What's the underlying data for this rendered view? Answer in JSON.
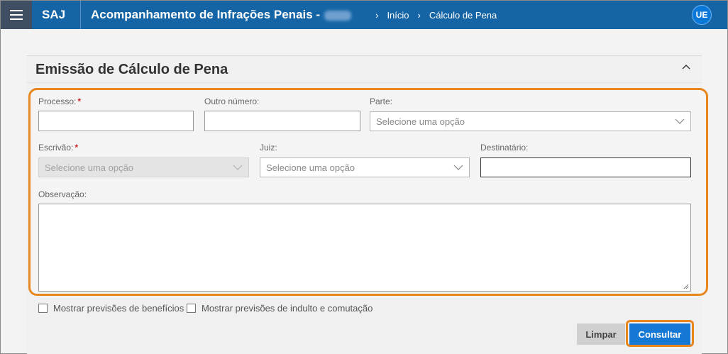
{
  "topbar": {
    "brand": "SAJ",
    "app_title": "Acompanhamento de Infrações Penais -",
    "breadcrumb": [
      {
        "label": "Início"
      },
      {
        "label": "Cálculo de Pena"
      }
    ],
    "user_initials": "UE"
  },
  "panel": {
    "title": "Emissão de Cálculo de Pena"
  },
  "form": {
    "processo": {
      "label": "Processo:",
      "required_mark": "*",
      "value": ""
    },
    "outro_numero": {
      "label": "Outro número:",
      "value": ""
    },
    "parte": {
      "label": "Parte:",
      "placeholder": "Selecione uma opção"
    },
    "escrivao": {
      "label": "Escrivão:",
      "required_mark": "*",
      "placeholder": "Selecione uma opção"
    },
    "juiz": {
      "label": "Juiz:",
      "placeholder": "Selecione uma opção"
    },
    "destinatario": {
      "label": "Destinatário:",
      "value": ""
    },
    "observacao": {
      "label": "Observação:",
      "value": ""
    }
  },
  "options": {
    "beneficios": "Mostrar previsões de benefícios",
    "indulto": "Mostrar previsões de indulto e comutação"
  },
  "actions": {
    "clear_label": "Limpar",
    "submit_label": "Consultar"
  },
  "colors": {
    "topbar": "#1565a6",
    "highlight": "#e8871e",
    "primary": "#1478d4"
  }
}
